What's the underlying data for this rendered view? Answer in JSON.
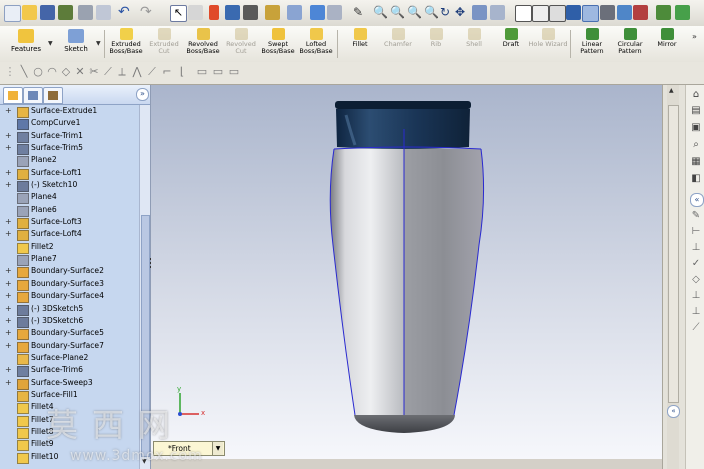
{
  "command_manager": {
    "features_label": "Features",
    "sketch_label": "Sketch",
    "buttons": [
      {
        "label": "Extruded Boss/Base",
        "enabled": true
      },
      {
        "label": "Extruded Cut",
        "enabled": false
      },
      {
        "label": "Revolved Boss/Base",
        "enabled": true
      },
      {
        "label": "Revolved Cut",
        "enabled": false
      },
      {
        "label": "Swept Boss/Base",
        "enabled": true
      },
      {
        "label": "Lofted Boss/Base",
        "enabled": true
      },
      {
        "label": "Fillet",
        "enabled": true
      },
      {
        "label": "Chamfer",
        "enabled": false
      },
      {
        "label": "Rib",
        "enabled": false
      },
      {
        "label": "Shell",
        "enabled": false
      },
      {
        "label": "Draft",
        "enabled": true
      },
      {
        "label": "Hole Wizard",
        "enabled": false
      },
      {
        "label": "Linear Pattern",
        "enabled": true
      },
      {
        "label": "Circular Pattern",
        "enabled": true
      },
      {
        "label": "Mirror",
        "enabled": true
      }
    ]
  },
  "feature_tree": {
    "items": [
      {
        "label": "Surface-Extrude1",
        "expandable": true,
        "icon": "surface-feature-icon"
      },
      {
        "label": "CompCurve1",
        "expandable": false,
        "icon": "curve-icon"
      },
      {
        "label": "Surface-Trim1",
        "expandable": true,
        "icon": "surface-trim-icon"
      },
      {
        "label": "Surface-Trim5",
        "expandable": true,
        "icon": "surface-trim-icon"
      },
      {
        "label": "Plane2",
        "expandable": false,
        "icon": "plane-icon"
      },
      {
        "label": "Surface-Loft1",
        "expandable": true,
        "icon": "loft-icon"
      },
      {
        "label": "(-) Sketch10",
        "expandable": true,
        "icon": "sketch-icon"
      },
      {
        "label": "Plane4",
        "expandable": false,
        "icon": "plane-icon"
      },
      {
        "label": "Plane6",
        "expandable": false,
        "icon": "plane-icon"
      },
      {
        "label": "Surface-Loft3",
        "expandable": true,
        "icon": "loft-icon"
      },
      {
        "label": "Surface-Loft4",
        "expandable": true,
        "icon": "loft-icon"
      },
      {
        "label": "Fillet2",
        "expandable": false,
        "icon": "fillet-icon"
      },
      {
        "label": "Plane7",
        "expandable": false,
        "icon": "plane-icon"
      },
      {
        "label": "Boundary-Surface2",
        "expandable": true,
        "icon": "boundary-surface-icon"
      },
      {
        "label": "Boundary-Surface3",
        "expandable": true,
        "icon": "boundary-surface-icon"
      },
      {
        "label": "Boundary-Surface4",
        "expandable": true,
        "icon": "boundary-surface-icon"
      },
      {
        "label": "(-) 3DSketch5",
        "expandable": true,
        "icon": "3dsketch-icon"
      },
      {
        "label": "(-) 3DSketch6",
        "expandable": true,
        "icon": "3dsketch-icon"
      },
      {
        "label": "Boundary-Surface5",
        "expandable": true,
        "icon": "boundary-surface-icon"
      },
      {
        "label": "Boundary-Surface7",
        "expandable": true,
        "icon": "boundary-surface-icon"
      },
      {
        "label": "Surface-Plane2",
        "expandable": false,
        "icon": "surface-plane-icon"
      },
      {
        "label": "Surface-Trim6",
        "expandable": true,
        "icon": "surface-trim-icon"
      },
      {
        "label": "Surface-Sweep3",
        "expandable": true,
        "icon": "sweep-icon"
      },
      {
        "label": "Surface-Fill1",
        "expandable": false,
        "icon": "fill-icon"
      },
      {
        "label": "Fillet4",
        "expandable": false,
        "icon": "fillet-icon"
      },
      {
        "label": "Fillet7",
        "expandable": false,
        "icon": "fillet-icon"
      },
      {
        "label": "Fillet8",
        "expandable": false,
        "icon": "fillet-icon"
      },
      {
        "label": "Fillet9",
        "expandable": false,
        "icon": "fillet-icon"
      },
      {
        "label": "Fillet10",
        "expandable": false,
        "icon": "fillet-icon"
      }
    ]
  },
  "viewport": {
    "view_name": "*Front",
    "triad_x": "x",
    "triad_y": "y"
  },
  "watermark": {
    "text_cn": "莫西网",
    "url": "www.3dmox.com"
  },
  "colors": {
    "tree_bg": "#c6d7ef",
    "cap": "#17324d",
    "body_light": "#d8dadf",
    "edge": "#2a2ad0"
  }
}
